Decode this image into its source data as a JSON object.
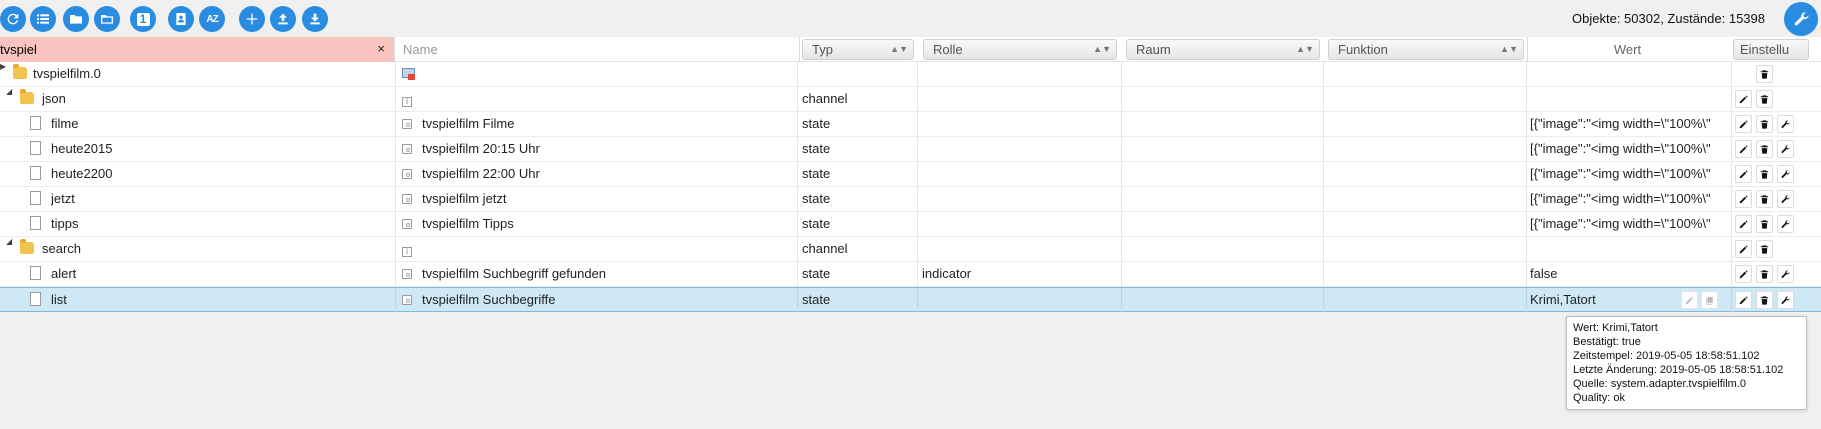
{
  "toolbar": {
    "buttons": [
      {
        "icon": "refresh-icon"
      },
      {
        "icon": "list-icon"
      },
      {
        "icon": "folder-icon"
      },
      {
        "icon": "folder-open-icon"
      },
      {
        "icon": "one-icon"
      },
      {
        "icon": "contact-icon"
      },
      {
        "icon": "sort-az-icon"
      },
      {
        "icon": "add-icon"
      },
      {
        "icon": "upload-icon"
      },
      {
        "icon": "download-icon"
      }
    ],
    "one_glyph": "1",
    "az_glyph": "AZ",
    "counts": "Objekte: 50302, Zustände: 15398"
  },
  "header": {
    "filter_value": "tvspiel",
    "clear_glyph": "×",
    "name_placeholder": "Name",
    "typ_label": "Typ",
    "rolle_label": "Rolle",
    "raum_label": "Raum",
    "funktion_label": "Funktion",
    "wert_label": "Wert",
    "einstellungen_label": "Einstellu",
    "sort_glyph": "▲▼"
  },
  "rows": [
    {
      "id": "tvspielfilm.0",
      "name": "",
      "type": "",
      "role": "",
      "value": ""
    },
    {
      "id": "json",
      "name": "",
      "type": "channel",
      "role": "",
      "value": ""
    },
    {
      "id": "filme",
      "name": "tvspielfilm Filme",
      "type": "state",
      "role": "",
      "value": "[{\"image\":\"<img width=\\\"100%\\\""
    },
    {
      "id": "heute2015",
      "name": "tvspielfilm 20:15 Uhr",
      "type": "state",
      "role": "",
      "value": "[{\"image\":\"<img width=\\\"100%\\\""
    },
    {
      "id": "heute2200",
      "name": "tvspielfilm 22:00 Uhr",
      "type": "state",
      "role": "",
      "value": "[{\"image\":\"<img width=\\\"100%\\\""
    },
    {
      "id": "jetzt",
      "name": "tvspielfilm jetzt",
      "type": "state",
      "role": "",
      "value": "[{\"image\":\"<img width=\\\"100%\\\""
    },
    {
      "id": "tipps",
      "name": "tvspielfilm Tipps",
      "type": "state",
      "role": "",
      "value": "[{\"image\":\"<img width=\\\"100%\\\""
    },
    {
      "id": "search",
      "name": "",
      "type": "channel",
      "role": "",
      "value": ""
    },
    {
      "id": "alert",
      "name": "tvspielfilm Suchbegriff gefunden",
      "type": "state",
      "role": "indicator",
      "value": "false"
    },
    {
      "id": "list",
      "name": "tvspielfilm Suchbegriffe",
      "type": "state",
      "role": "",
      "value": "Krimi,Tatort"
    }
  ],
  "glyphs": {
    "expand_closed": "▶",
    "expand_open": "◢",
    "info": "i"
  },
  "tooltip": {
    "lines": [
      "Wert: Krimi,Tatort",
      "Bestätigt: true",
      "Zeitstempel: 2019-05-05 18:58:51.102",
      "Letzte Änderung: 2019-05-05 18:58:51.102",
      "Quelle: system.adapter.tvspielfilm.0",
      "Quality: ok"
    ]
  },
  "colors": {
    "accent": "#2a8ce0",
    "filter_bg": "#f9c4c0",
    "selected_row": "#cfe8f6"
  }
}
